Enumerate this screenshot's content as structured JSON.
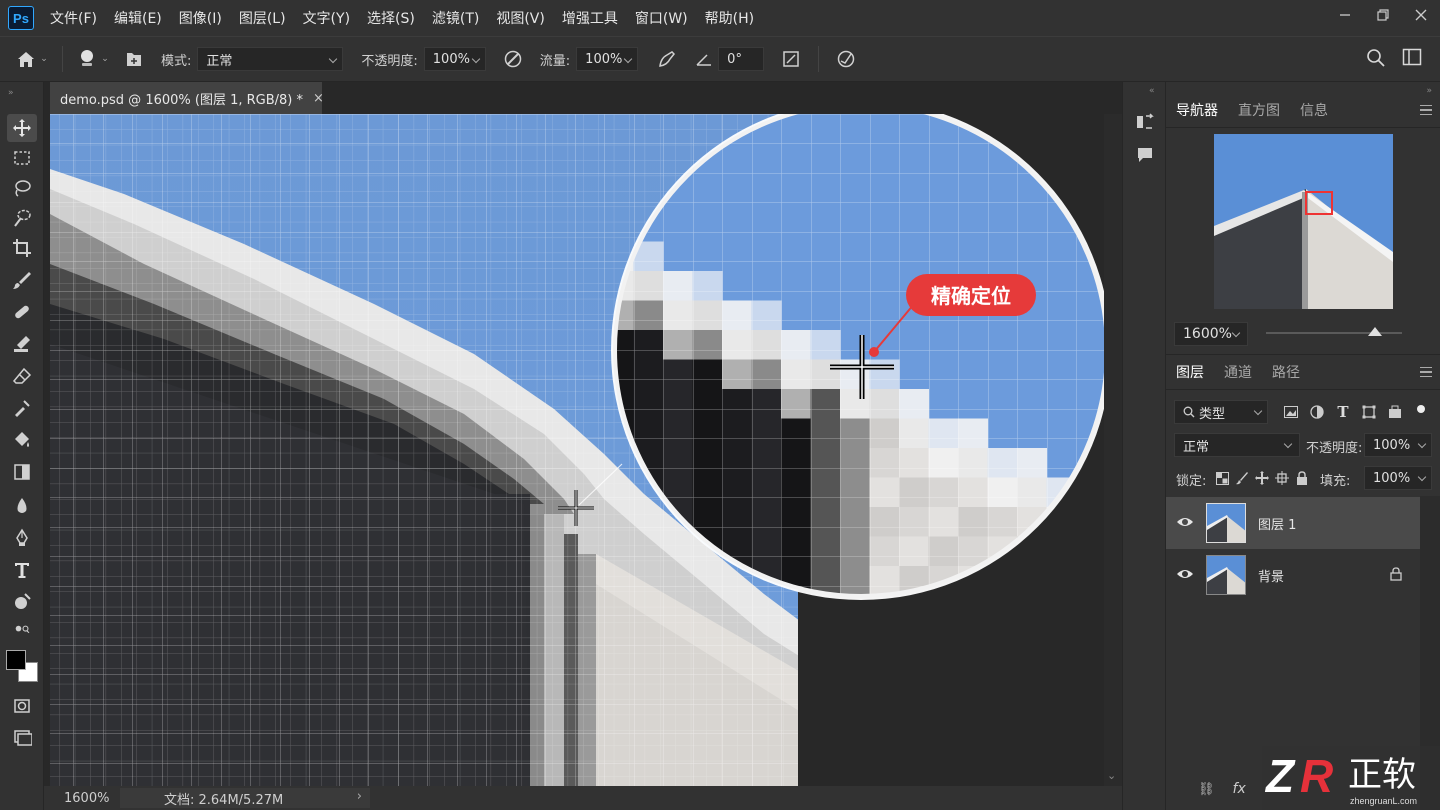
{
  "app": {
    "logo": "Ps"
  },
  "menu": [
    "文件(F)",
    "编辑(E)",
    "图像(I)",
    "图层(L)",
    "文字(Y)",
    "选择(S)",
    "滤镜(T)",
    "视图(V)",
    "增强工具",
    "窗口(W)",
    "帮助(H)"
  ],
  "options": {
    "mode_label": "模式:",
    "mode_value": "正常",
    "opacity_label": "不透明度:",
    "opacity_value": "100%",
    "flow_label": "流量:",
    "flow_value": "100%",
    "angle_value": "0°"
  },
  "document": {
    "tab_title": "demo.psd @ 1600% (图层 1, RGB/8) *",
    "close_glyph": "×"
  },
  "callout": {
    "label": "精确定位"
  },
  "status": {
    "zoom": "1600%",
    "doc_info": "文档: 2.64M/5.27M",
    "arrow": "›"
  },
  "navigator": {
    "tabs": [
      "导航器",
      "直方图",
      "信息"
    ],
    "zoom_value": "1600%",
    "zoom_slider_fraction": 0.8
  },
  "layers_panel": {
    "tabs": [
      "图层",
      "通道",
      "路径"
    ],
    "filter_label": "类型",
    "blend_mode": "正常",
    "opacity_label": "不透明度:",
    "opacity_value": "100%",
    "lock_label": "锁定:",
    "fill_label": "填充:",
    "fill_value": "100%",
    "layers": [
      {
        "name": "图层 1",
        "selected": true,
        "locked": false
      },
      {
        "name": "背景",
        "selected": false,
        "locked": true
      }
    ],
    "footer": {
      "link": "⛓",
      "fx": "fx"
    }
  },
  "watermark": {
    "text": "正软",
    "sub": "zhengruanL.com"
  },
  "colors": {
    "accent": "#31a8ff",
    "callout": "#e63a3a",
    "sky": "#6e9bd8",
    "panel_bg": "#323232"
  },
  "icons": {
    "home": "home-icon",
    "brush": "brush-icon",
    "move": "move-tool-icon",
    "search": "search-icon"
  }
}
